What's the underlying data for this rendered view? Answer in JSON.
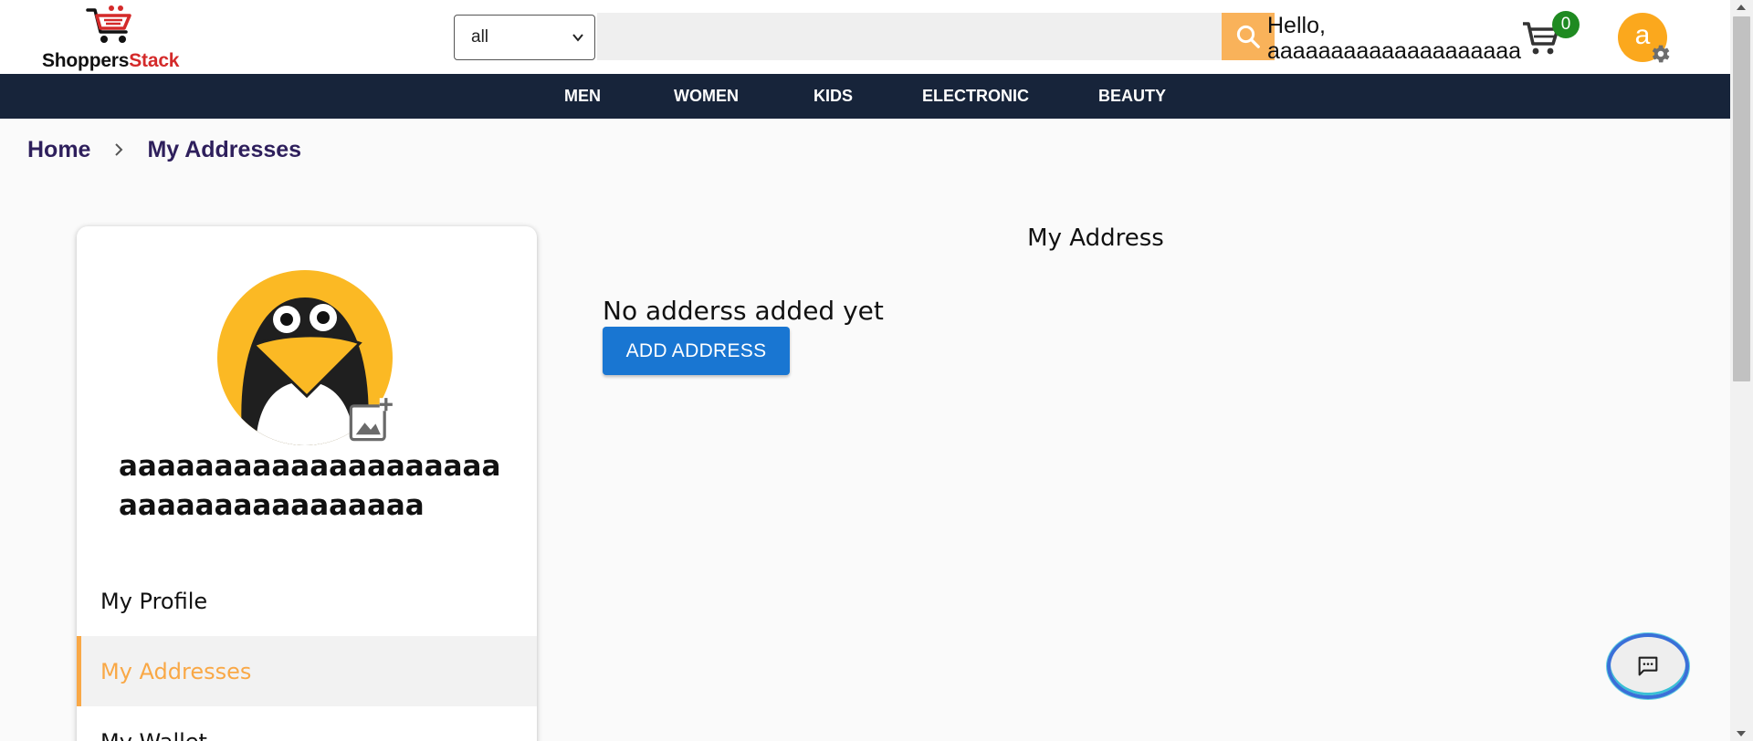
{
  "header": {
    "logo": {
      "part1": "Shoppers",
      "part2": "Stack"
    },
    "category_select": {
      "value": "all"
    },
    "search": {
      "value": "",
      "placeholder": ""
    },
    "greeting_line1": "Hello,",
    "greeting_line2": "aaaaaaaaaaaaaaaaaaaa",
    "cart_count": "0",
    "avatar_initial": "a"
  },
  "nav": {
    "items": [
      {
        "label": "MEN"
      },
      {
        "label": "WOMEN"
      },
      {
        "label": "KIDS"
      },
      {
        "label": "ELECTRONIC"
      },
      {
        "label": "BEAUTY"
      }
    ]
  },
  "breadcrumb": {
    "home": "Home",
    "current": "My Addresses"
  },
  "sidebar": {
    "profile_name": "aaaaaaaaaaaaaaaaaaaaaaaaaaaaaaaaaaaa",
    "menu": [
      {
        "label": "My Profile"
      },
      {
        "label": "My Addresses",
        "active": true
      },
      {
        "label": "My Wallet"
      }
    ]
  },
  "main": {
    "title": "My Address",
    "empty_message": "No adderss added yet",
    "add_button_label": "ADD ADDRESS"
  },
  "colors": {
    "nav_bg": "#17243a",
    "accent_orange": "#f9b25a",
    "active_menu": "#f9a846",
    "primary_blue": "#1976d2",
    "badge_green": "#1f8a21",
    "logo_red": "#d42a2a",
    "breadcrumb_text": "#2e1f5c"
  },
  "icons": {
    "search": "search-icon",
    "cart": "cart-icon",
    "settings": "gear-icon",
    "add_photo": "add-photo-icon",
    "chat": "chat-icon",
    "chevron": "chevron-right-icon"
  }
}
